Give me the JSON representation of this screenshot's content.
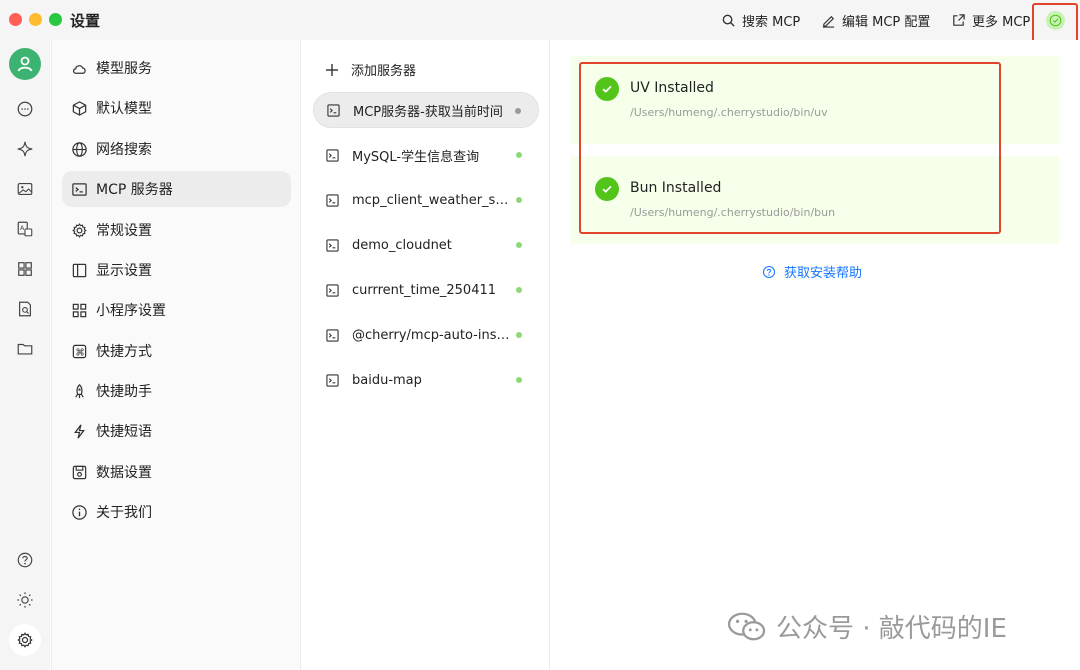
{
  "window": {
    "title": "设置"
  },
  "toolbar": {
    "search_label": "搜索 MCP",
    "edit_label": "编辑 MCP 配置",
    "more_label": "更多 MCP",
    "status_icon": "check-circle-icon"
  },
  "rail": {
    "items": [
      "avatar",
      "chat-icon",
      "sparkle-icon",
      "image-icon",
      "translate-icon",
      "apps-icon",
      "doc-search-icon",
      "folder-icon",
      "help-icon",
      "theme-icon",
      "gear-icon"
    ]
  },
  "settings_nav": {
    "items": [
      {
        "label": "模型服务",
        "icon": "cloud-icon"
      },
      {
        "label": "默认模型",
        "icon": "cube-icon"
      },
      {
        "label": "网络搜索",
        "icon": "globe-icon"
      },
      {
        "label": "MCP 服务器",
        "icon": "terminal-icon"
      },
      {
        "label": "常规设置",
        "icon": "gear-icon"
      },
      {
        "label": "显示设置",
        "icon": "layout-icon"
      },
      {
        "label": "小程序设置",
        "icon": "grid-icon"
      },
      {
        "label": "快捷方式",
        "icon": "command-icon"
      },
      {
        "label": "快捷助手",
        "icon": "rocket-icon"
      },
      {
        "label": "快捷短语",
        "icon": "bolt-icon"
      },
      {
        "label": "数据设置",
        "icon": "disk-icon"
      },
      {
        "label": "关于我们",
        "icon": "info-icon"
      }
    ],
    "active_index": 3
  },
  "servers": {
    "add_label": "添加服务器",
    "items": [
      {
        "name": "MCP服务器-获取当前时间",
        "status_color": "#9a9a9a"
      },
      {
        "name": "MySQL-学生信息查询",
        "status_color": "#8fd87a"
      },
      {
        "name": "mcp_client_weather_se...",
        "status_color": "#8fd87a"
      },
      {
        "name": "demo_cloudnet",
        "status_color": "#8fd87a"
      },
      {
        "name": "currrent_time_250411",
        "status_color": "#8fd87a"
      },
      {
        "name": "@cherry/mcp-auto-install",
        "status_color": "#8fd87a"
      },
      {
        "name": "baidu-map",
        "status_color": "#8fd87a"
      }
    ],
    "active_index": 0
  },
  "install_status": {
    "uv": {
      "title": "UV Installed",
      "path": "/Users/humeng/.cherrystudio/bin/uv"
    },
    "bun": {
      "title": "Bun Installed",
      "path": "/Users/humeng/.cherrystudio/bin/bun"
    },
    "help_label": "获取安装帮助"
  },
  "watermark": {
    "text": "公众号 · 敲代码的IE"
  },
  "colors": {
    "accent": "#1677ff",
    "success": "#52c41a",
    "highlight": "#e0442b"
  }
}
